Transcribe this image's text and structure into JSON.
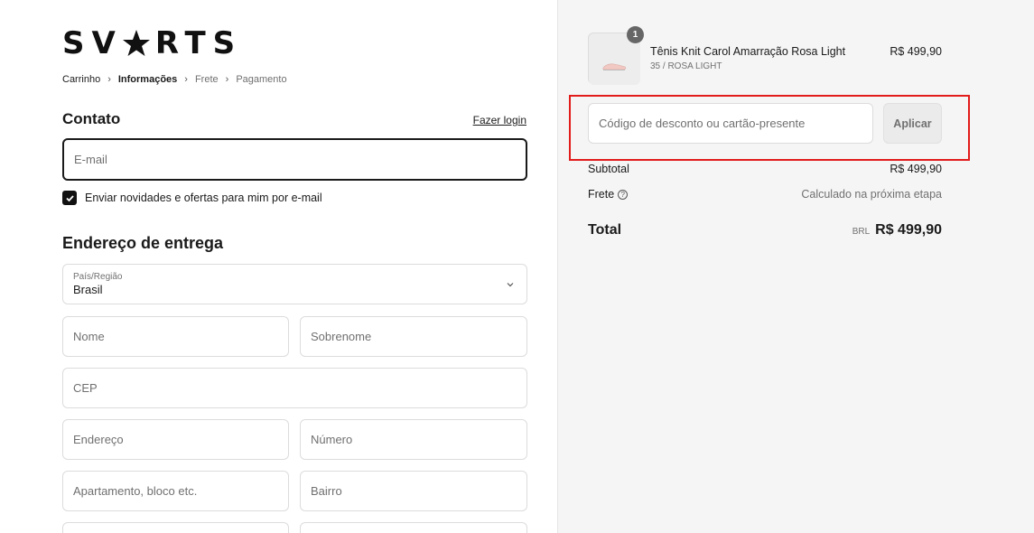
{
  "brand": {
    "logo_left": "SV",
    "logo_right": "RTS"
  },
  "breadcrumb": [
    "Carrinho",
    "Informações",
    "Frete",
    "Pagamento"
  ],
  "contact": {
    "heading": "Contato",
    "login_link": "Fazer login",
    "email_placeholder": "E-mail",
    "newsletter_label": "Enviar novidades e ofertas para mim por e-mail",
    "newsletter_checked": true
  },
  "address": {
    "heading": "Endereço de entrega",
    "country_label": "País/Região",
    "country_value": "Brasil",
    "first_name": "Nome",
    "last_name": "Sobrenome",
    "cep": "CEP",
    "street": "Endereço",
    "number": "Número",
    "apartment": "Apartamento, bloco etc.",
    "neighborhood": "Bairro"
  },
  "cart": {
    "item": {
      "quantity": "1",
      "name": "Tênis Knit Carol Amarração Rosa Light",
      "variant": "35 / ROSA LIGHT",
      "price": "R$ 499,90"
    },
    "discount_placeholder": "Código de desconto ou cartão-presente",
    "apply_label": "Aplicar",
    "subtotal_label": "Subtotal",
    "subtotal_value": "R$ 499,90",
    "shipping_label": "Frete",
    "shipping_value": "Calculado na próxima etapa",
    "total_label": "Total",
    "total_currency": "BRL",
    "total_value": "R$ 499,90"
  },
  "colors": {
    "highlight": "#e21b1b",
    "sidebar_bg": "#f5f5f5"
  }
}
